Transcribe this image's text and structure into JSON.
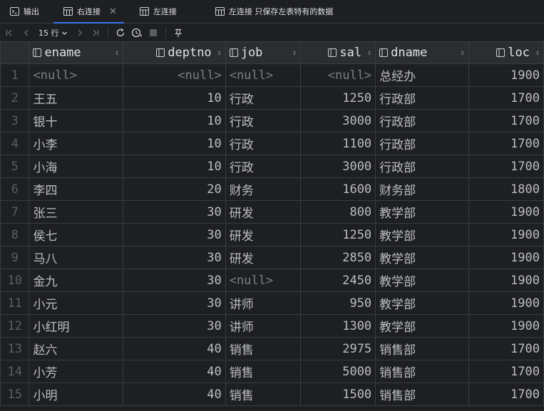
{
  "tabs": [
    {
      "label": "输出",
      "icon": "console-icon",
      "active": false,
      "closable": false
    },
    {
      "label": "右连接",
      "icon": "table-icon",
      "active": true,
      "closable": true
    },
    {
      "label": "左连接",
      "icon": "table-icon",
      "active": false,
      "closable": false
    },
    {
      "label": "左连接 只保存左表特有的数据",
      "icon": "table-icon",
      "active": false,
      "closable": false
    }
  ],
  "toolbar": {
    "rows_label": "15 行"
  },
  "columns": [
    "ename",
    "deptno",
    "job",
    "sal",
    "dname",
    "loc"
  ],
  "rows": [
    {
      "n": "1",
      "ename": "<null>",
      "deptno": "<null>",
      "job": "<null>",
      "sal": "<null>",
      "dname": "总经办",
      "loc": "1900"
    },
    {
      "n": "2",
      "ename": "王五",
      "deptno": "10",
      "job": "行政",
      "sal": "1250",
      "dname": "行政部",
      "loc": "1700"
    },
    {
      "n": "3",
      "ename": "银十",
      "deptno": "10",
      "job": "行政",
      "sal": "3000",
      "dname": "行政部",
      "loc": "1700"
    },
    {
      "n": "4",
      "ename": "小李",
      "deptno": "10",
      "job": "行政",
      "sal": "1100",
      "dname": "行政部",
      "loc": "1700"
    },
    {
      "n": "5",
      "ename": "小海",
      "deptno": "10",
      "job": "行政",
      "sal": "3000",
      "dname": "行政部",
      "loc": "1700"
    },
    {
      "n": "6",
      "ename": "李四",
      "deptno": "20",
      "job": "财务",
      "sal": "1600",
      "dname": "财务部",
      "loc": "1800"
    },
    {
      "n": "7",
      "ename": "张三",
      "deptno": "30",
      "job": "研发",
      "sal": "800",
      "dname": "教学部",
      "loc": "1900"
    },
    {
      "n": "8",
      "ename": "侯七",
      "deptno": "30",
      "job": "研发",
      "sal": "1250",
      "dname": "教学部",
      "loc": "1900"
    },
    {
      "n": "9",
      "ename": "马八",
      "deptno": "30",
      "job": "研发",
      "sal": "2850",
      "dname": "教学部",
      "loc": "1900"
    },
    {
      "n": "10",
      "ename": "金九",
      "deptno": "30",
      "job": "<null>",
      "sal": "2450",
      "dname": "教学部",
      "loc": "1900"
    },
    {
      "n": "11",
      "ename": "小元",
      "deptno": "30",
      "job": "讲师",
      "sal": "950",
      "dname": "教学部",
      "loc": "1900"
    },
    {
      "n": "12",
      "ename": "小红明",
      "deptno": "30",
      "job": "讲师",
      "sal": "1300",
      "dname": "教学部",
      "loc": "1900"
    },
    {
      "n": "13",
      "ename": "赵六",
      "deptno": "40",
      "job": "销售",
      "sal": "2975",
      "dname": "销售部",
      "loc": "1700"
    },
    {
      "n": "14",
      "ename": "小芳",
      "deptno": "40",
      "job": "销售",
      "sal": "5000",
      "dname": "销售部",
      "loc": "1700"
    },
    {
      "n": "15",
      "ename": "小明",
      "deptno": "40",
      "job": "销售",
      "sal": "1500",
      "dname": "销售部",
      "loc": "1700"
    }
  ],
  "colors": {
    "background": "#1e1f22",
    "header_bg": "#2b2d30",
    "grid_line": "#393b40",
    "accent": "#3574f0",
    "null_text": "#7a7e85"
  }
}
